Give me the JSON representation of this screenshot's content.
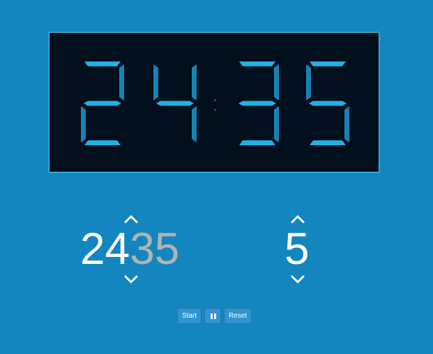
{
  "theme": {
    "background": "#1386c0",
    "display_background": "#020f1c",
    "segment_on": "#1fb0e6",
    "segment_dark": "#1683b5",
    "colon_color": "#1d4a66",
    "button_background": "#2e95cf",
    "button_text": "#ffffff"
  },
  "display": {
    "digits": [
      "2",
      "4",
      "3",
      "5"
    ],
    "separator": ":"
  },
  "timer_setting": {
    "minutes": "24",
    "seconds": "35"
  },
  "step_setting": {
    "value": "5"
  },
  "icons": {
    "increment": "chevron-up-icon",
    "decrement": "chevron-down-icon",
    "pause": "pause-icon"
  },
  "buttons": {
    "start_label": "Start",
    "reset_label": "Reset"
  }
}
